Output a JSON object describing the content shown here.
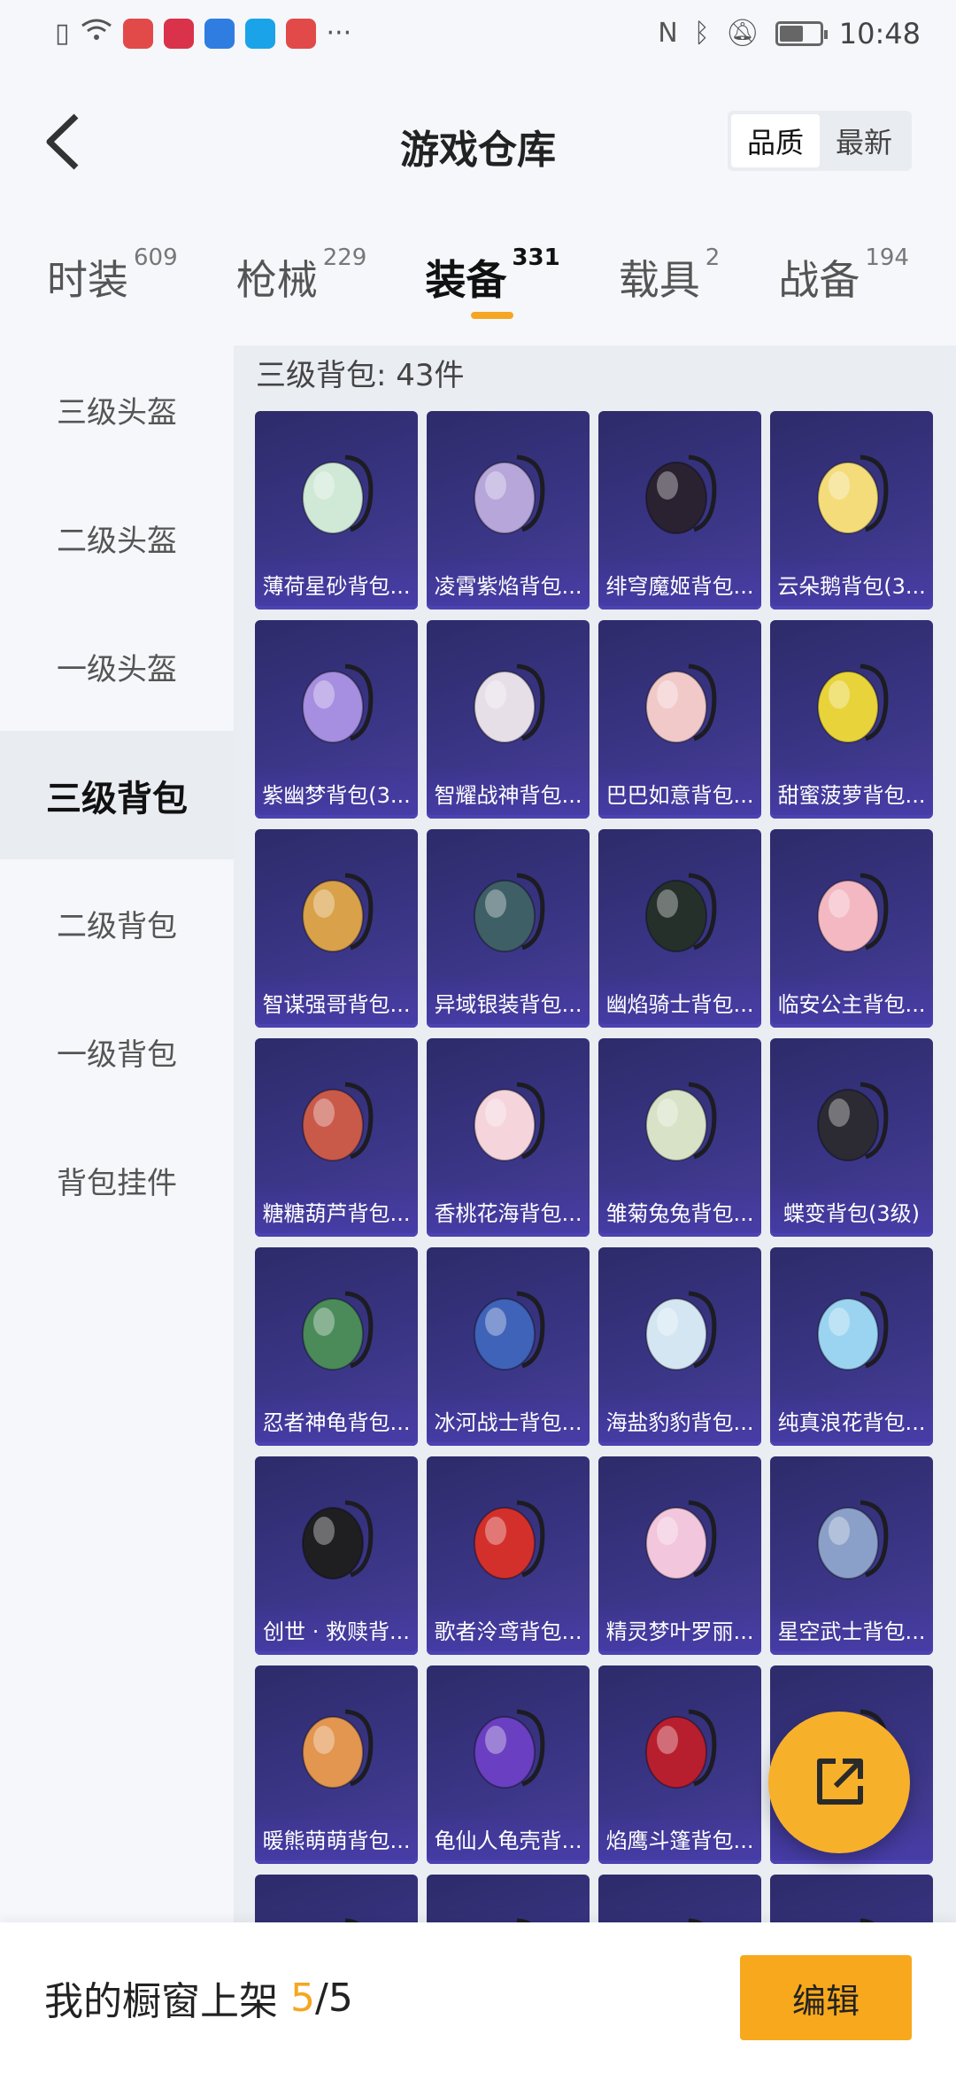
{
  "status_bar": {
    "time": "10:48",
    "more_glyph": "···",
    "battery_level": 0.6
  },
  "header": {
    "title": "游戏仓库",
    "sort_options": [
      {
        "label": "品质",
        "active": true
      },
      {
        "label": "最新",
        "active": false
      }
    ]
  },
  "category_tabs": [
    {
      "label": "时装",
      "count": "609"
    },
    {
      "label": "枪械",
      "count": "229"
    },
    {
      "label": "装备",
      "count": "331",
      "active": true
    },
    {
      "label": "载具",
      "count": "2"
    },
    {
      "label": "战备",
      "count": "194"
    }
  ],
  "sidebar": {
    "items": [
      {
        "label": "三级头盔"
      },
      {
        "label": "二级头盔"
      },
      {
        "label": "一级头盔"
      },
      {
        "label": "三级背包",
        "active": true
      },
      {
        "label": "二级背包"
      },
      {
        "label": "一级背包"
      },
      {
        "label": "背包挂件"
      }
    ]
  },
  "main": {
    "section_title": "三级背包: 43件",
    "items": [
      {
        "name": "薄荷星砂背包...",
        "color": "#cfe9d6"
      },
      {
        "name": "凌霄紫焰背包...",
        "color": "#b6a6d9"
      },
      {
        "name": "绯穹魔姬背包...",
        "color": "#2a2230"
      },
      {
        "name": "云朵鹅背包(3...",
        "color": "#f4dc7a"
      },
      {
        "name": "紫幽梦背包(3...",
        "color": "#a68ee0"
      },
      {
        "name": "智耀战神背包...",
        "color": "#e7dfe8"
      },
      {
        "name": "巴巴如意背包...",
        "color": "#f1c9c9"
      },
      {
        "name": "甜蜜菠萝背包...",
        "color": "#e8d43a"
      },
      {
        "name": "智谋强哥背包...",
        "color": "#d9a24a"
      },
      {
        "name": "异域银装背包...",
        "color": "#3e5f66"
      },
      {
        "name": "幽焰骑士背包...",
        "color": "#26302b"
      },
      {
        "name": "临安公主背包...",
        "color": "#f3b8c2"
      },
      {
        "name": "糖糖葫芦背包...",
        "color": "#c95a4a"
      },
      {
        "name": "香桃花海背包...",
        "color": "#f5d4dc"
      },
      {
        "name": "雏菊兔兔背包...",
        "color": "#d8e2c6"
      },
      {
        "name": "蝶变背包(3级)",
        "color": "#2c2a32"
      },
      {
        "name": "忍者神龟背包...",
        "color": "#4b8b5a"
      },
      {
        "name": "冰河战士背包...",
        "color": "#3f63b8"
      },
      {
        "name": "海盐豹豹背包...",
        "color": "#d4e6f2"
      },
      {
        "name": "纯真浪花背包...",
        "color": "#9ad4f0"
      },
      {
        "name": "创世 · 救赎背...",
        "color": "#1f1f22"
      },
      {
        "name": "歌者泠鸢背包...",
        "color": "#d3302c"
      },
      {
        "name": "精灵梦叶罗丽...",
        "color": "#f2c6dc"
      },
      {
        "name": "星空武士背包...",
        "color": "#8aa0c8"
      },
      {
        "name": "暖熊萌萌背包...",
        "color": "#e29650"
      },
      {
        "name": "龟仙人龟壳背...",
        "color": "#6b3fc1"
      },
      {
        "name": "焰鹰斗篷背包...",
        "color": "#b81f2e"
      },
      {
        "name": "",
        "color": "#c34bc8"
      },
      {
        "name": "",
        "color": "#d9b6e9"
      },
      {
        "name": "",
        "color": "#b83a4a"
      },
      {
        "name": "",
        "color": "#c33a3a"
      },
      {
        "name": "",
        "color": "#6a6a6a"
      }
    ]
  },
  "bottom_bar": {
    "label": "我的橱窗上架",
    "current": "5",
    "total": "/5",
    "edit_label": "编辑"
  },
  "colors": {
    "accent": "#f7a81c",
    "card_bg": "#3a3585"
  }
}
